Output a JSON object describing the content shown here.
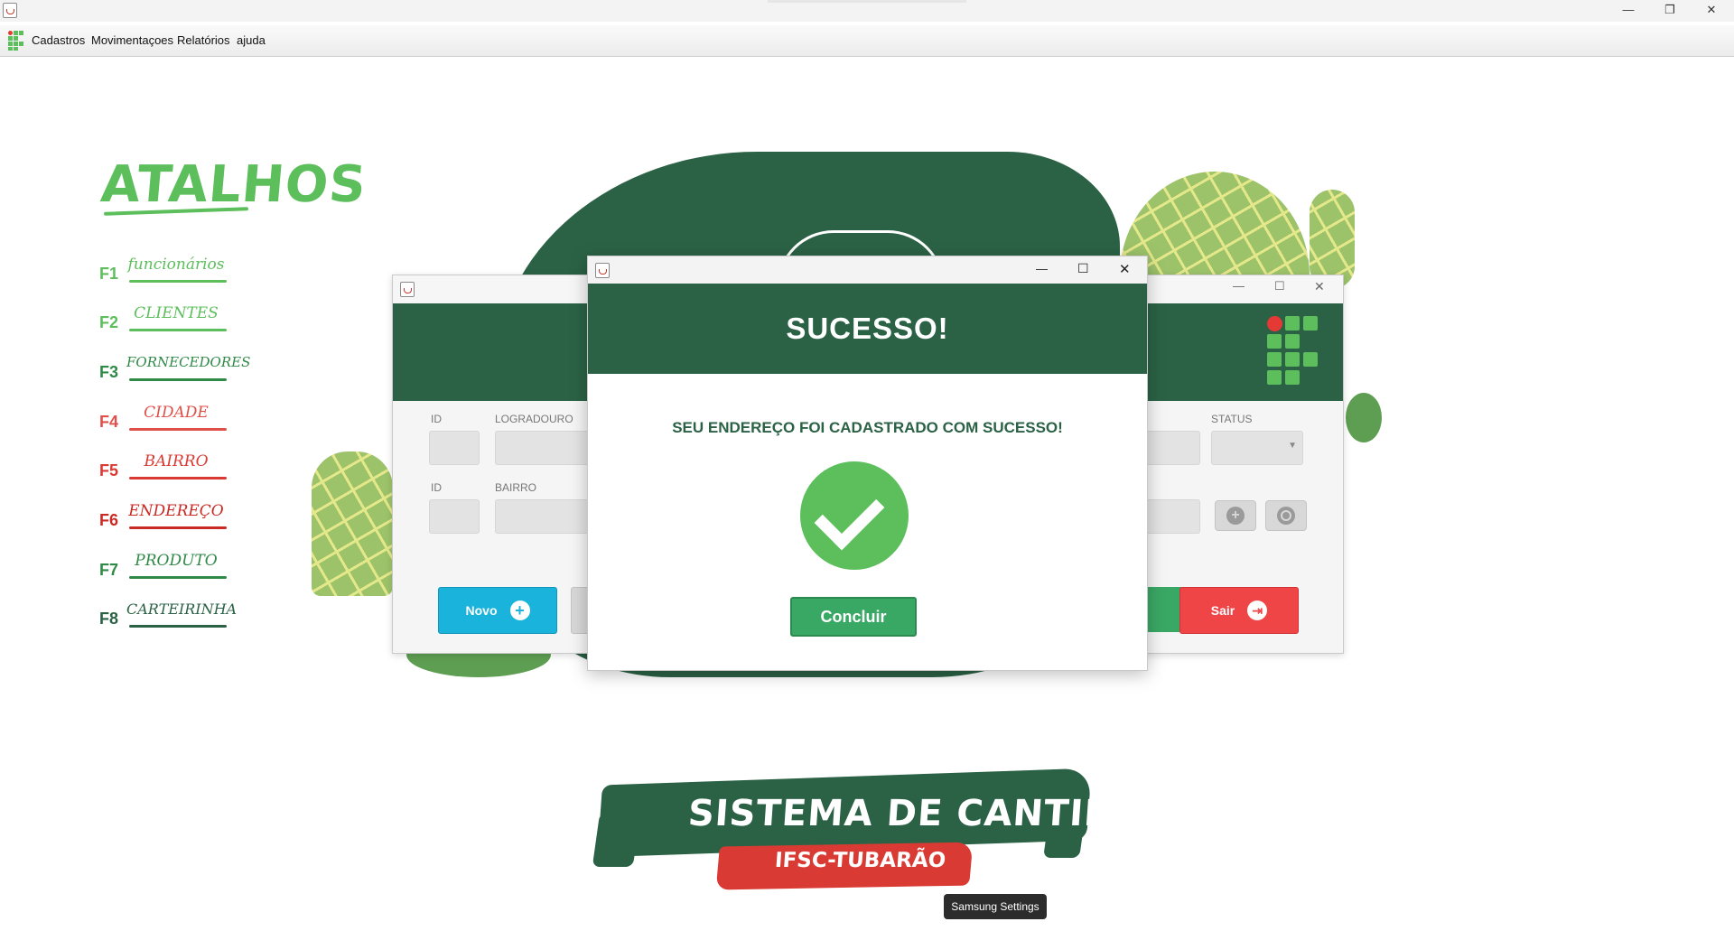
{
  "window": {
    "controls": [
      "—",
      "❐",
      "✕"
    ]
  },
  "menu": {
    "items": [
      "Cadastros",
      "Movimentaçoes",
      "Relatórios",
      "ajuda"
    ]
  },
  "shortcuts": {
    "title": "ATALHOS",
    "items": [
      {
        "key": "F1",
        "label": "funcionários",
        "color": "#5cbf5c"
      },
      {
        "key": "F2",
        "label": "CLIENTES",
        "color": "#5cbf5c"
      },
      {
        "key": "F3",
        "label": "FORNECEDORES",
        "color": "#2f8a47"
      },
      {
        "key": "F4",
        "label": "CIDADE",
        "color": "#e0504a"
      },
      {
        "key": "F5",
        "label": "BAIRRO",
        "color": "#d93a33"
      },
      {
        "key": "F6",
        "label": "ENDEREÇO",
        "color": "#c92a24"
      },
      {
        "key": "F7",
        "label": "PRODUTO",
        "color": "#2f8a47"
      },
      {
        "key": "F8",
        "label": "CARTEIRINHA",
        "color": "#2b6245"
      }
    ]
  },
  "form": {
    "labels": {
      "id1": "ID",
      "logradouro": "LOGRADOURO",
      "status": "STATUS",
      "id2": "ID",
      "bairro": "BAIRRO"
    },
    "buttons": {
      "novo": "Novo",
      "sair": "Sair"
    }
  },
  "dialog": {
    "title": "SUCESSO!",
    "message": "SEU ENDEREÇO FOI CADASTRADO COM SUCESSO!",
    "button": "Concluir",
    "controls": [
      "—",
      "☐",
      "✕"
    ]
  },
  "brand": {
    "title": "SISTEMA DE CANTINA",
    "subtitle": "IFSC-TUBARÃO"
  },
  "tooltip": {
    "text": "Samsung Settings"
  },
  "colors": {
    "dark_green": "#2b6245",
    "green": "#5cbf5c",
    "red": "#ef4546",
    "cyan": "#1ab3dc"
  }
}
